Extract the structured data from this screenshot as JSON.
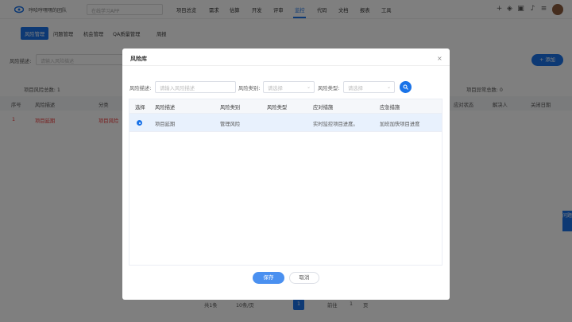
{
  "header": {
    "team": "哼哈哼嘿嘿的团队",
    "app_select_placeholder": "在线学习APP",
    "nav": [
      "项目总览",
      "需求",
      "估算",
      "开发",
      "评审",
      "监控",
      "代码",
      "文档",
      "报表",
      "工具"
    ],
    "active_nav_index": 5
  },
  "subnav": [
    "风险管理",
    "问题管理",
    "机会管理",
    "QA质量管理",
    "周报"
  ],
  "background": {
    "filter_label": "风险描述:",
    "filter_placeholder": "请输入风险描述",
    "add_button": "+ 添加",
    "stats": {
      "total": "项目风险总数:  1",
      "exceptions": "项目异常总数:  0"
    },
    "columns": [
      "序号",
      "风险描述",
      "分类",
      "应对状态",
      "解决人",
      "关闭日期"
    ],
    "row": {
      "index": "1",
      "desc": "项目延期",
      "category": "项目风险"
    },
    "side_tab": "问题",
    "pager": {
      "total": "共1条",
      "size": "10条/页",
      "current": "1",
      "goto": "前往",
      "goto_page": "1",
      "page_unit": "页"
    }
  },
  "modal": {
    "title": "风险库",
    "close": "×",
    "filters": {
      "desc_label": "风险描述:",
      "desc_placeholder": "请输入风险描述",
      "category_label": "风险类别:",
      "category_placeholder": "请选择",
      "type_label": "风险类型:",
      "type_placeholder": "请选择"
    },
    "columns": [
      "选择",
      "风险描述",
      "风险类别",
      "风险类型",
      "应对措施",
      "应急措施"
    ],
    "rows": [
      {
        "selected": true,
        "desc": "项目延期",
        "category": "管理风险",
        "type": "",
        "response": "实时监控项目进度。",
        "contingency": "加班加快项目进度"
      }
    ],
    "save": "保存",
    "cancel": "取消"
  },
  "colors": {
    "accent": "#1a73e8",
    "overlay": "rgba(0,0,0,0.5)",
    "selected_row": "#e8f1fd"
  },
  "icons": [
    "logo-icon",
    "add-icon",
    "cube-icon",
    "briefcase-icon",
    "bell-icon",
    "settings-icon",
    "search-icon",
    "chevron-down-icon",
    "close-icon"
  ]
}
